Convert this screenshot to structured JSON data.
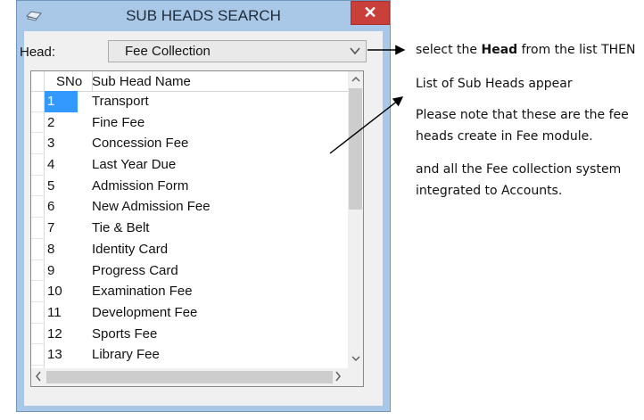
{
  "window": {
    "title": "SUB HEADS SEARCH",
    "close_symbol": "✕",
    "titlebar_color": "#a9c7e6",
    "close_color": "#c9403a"
  },
  "form": {
    "head_label": "Head:",
    "head_value": "Fee Collection"
  },
  "grid": {
    "columns": [
      "SNo",
      "Sub Head Name"
    ],
    "selected_color": "#3399ff",
    "rows": [
      {
        "sno": "1",
        "name": "Transport",
        "selected": true
      },
      {
        "sno": "2",
        "name": "Fine Fee"
      },
      {
        "sno": "3",
        "name": "Concession Fee"
      },
      {
        "sno": "4",
        "name": "Last Year Due"
      },
      {
        "sno": "5",
        "name": "Admission Form"
      },
      {
        "sno": "6",
        "name": "New Admission Fee"
      },
      {
        "sno": "7",
        "name": "Tie &  Belt"
      },
      {
        "sno": "8",
        "name": "Identity Card"
      },
      {
        "sno": "9",
        "name": "Progress Card"
      },
      {
        "sno": "10",
        "name": "Examination Fee"
      },
      {
        "sno": "11",
        "name": "Development Fee"
      },
      {
        "sno": "12",
        "name": "Sports Fee"
      },
      {
        "sno": "13",
        "name": "Library Fee"
      }
    ]
  },
  "annotations": {
    "line1_prefix": "select the ",
    "line1_bold": "Head",
    "line1_suffix": " from the list THEN",
    "line2": "List of  Sub Heads  appear",
    "line3": "Please note that  these are the fee",
    "line4": "heads  create in Fee module.",
    "line5": "and all the Fee collection system",
    "line6": "integrated to Accounts."
  }
}
